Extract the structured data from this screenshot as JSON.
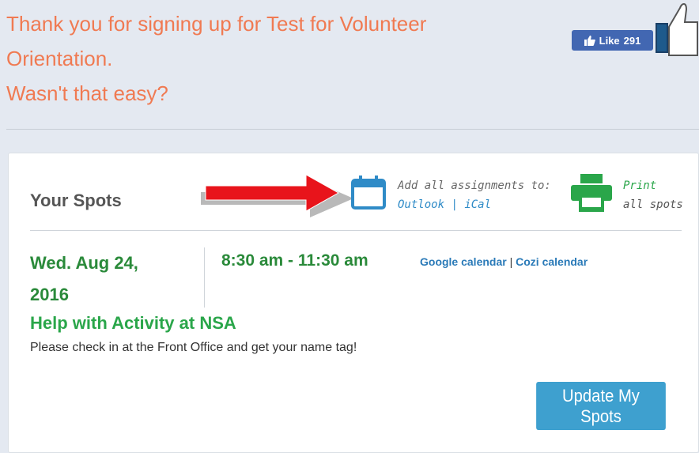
{
  "header": {
    "thanks_line1": "Thank you for signing up for Test for Volunteer",
    "thanks_line2": "Orientation.",
    "thanks_line3": "Wasn't that easy?",
    "like_label": "Like",
    "like_count": "291"
  },
  "spots": {
    "title": "Your Spots",
    "add_label": "Add all assignments to:",
    "outlook_label": "Outlook",
    "ical_label": "iCal",
    "link_separator": "|",
    "print_label": "Print",
    "print_sub": "all spots"
  },
  "assignment": {
    "date_line1": "Wed. Aug 24,",
    "date_line2": "2016",
    "time": "8:30 am - 11:30 am",
    "google_label": "Google calendar",
    "cozi_label": "Cozi calendar",
    "separator": "|",
    "activity": "Help with Activity at NSA",
    "instruction": "Please check in at the Front Office and get your name tag!"
  },
  "update_button": "Update My Spots",
  "colors": {
    "accent_orange": "#f07a52",
    "accent_green": "#2aa64a",
    "link_blue": "#2f8bc7",
    "button_blue": "#3ea0cf",
    "arrow_red": "#e8141b"
  },
  "icons": [
    "thumbs-up-icon",
    "calendar-icon",
    "printer-icon",
    "red-arrow-icon"
  ]
}
